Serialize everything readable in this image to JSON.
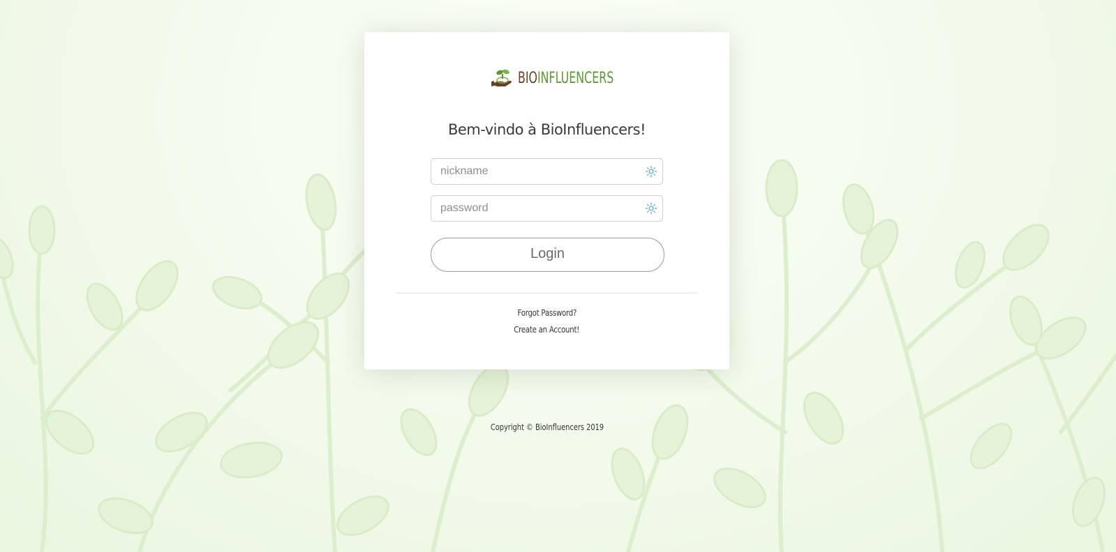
{
  "brand": {
    "logo_part1": "BIO",
    "logo_part2": "INFLUENCERS",
    "logo_icon": "hand-with-sprout-icon",
    "colors": {
      "brown": "#6b3f1e",
      "green": "#5a9a2a"
    }
  },
  "login": {
    "welcome": "Bem-vindo à BioInfluencers!",
    "nickname_placeholder": "nickname",
    "nickname_value": "",
    "password_placeholder": "password",
    "password_value": "",
    "field_icon": "key-sparkle-icon",
    "login_label": "Login"
  },
  "links": {
    "forgot_password": "Forgot Password?",
    "create_account": "Create an Account!"
  },
  "footer": {
    "copyright": "Copyright © BioInfluencers 2019"
  },
  "theme": {
    "background": "#f1f9e9",
    "card": "#ffffff",
    "input_icon_color": "#4aa3df"
  }
}
